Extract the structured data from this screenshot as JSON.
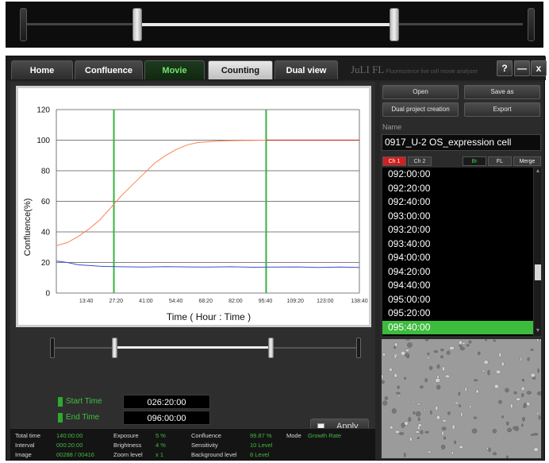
{
  "tabs": [
    {
      "label": "Home"
    },
    {
      "label": "Confluence"
    },
    {
      "label": "Movie"
    },
    {
      "label": "Counting"
    },
    {
      "label": "Dual view"
    }
  ],
  "brand": {
    "name": "JuLI FL",
    "tagline": "Fluorescence live cell movie analyzer"
  },
  "window_buttons": {
    "help": "?",
    "minimize": "—",
    "close": "x"
  },
  "chart_data": {
    "type": "line",
    "xlabel": "Time ( Hour : Time )",
    "ylabel": "Confluence(%)",
    "ylim": [
      0,
      120
    ],
    "yticks": [
      0,
      20,
      40,
      60,
      80,
      100,
      120
    ],
    "xlim": [
      0,
      138.67
    ],
    "xticks": [
      {
        "value": 13.67,
        "label": "13:40"
      },
      {
        "value": 27.33,
        "label": "27:20"
      },
      {
        "value": 41.0,
        "label": "41:00"
      },
      {
        "value": 54.67,
        "label": "54:40"
      },
      {
        "value": 68.33,
        "label": "68:20"
      },
      {
        "value": 82.0,
        "label": "82:00"
      },
      {
        "value": 95.67,
        "label": "95:40"
      },
      {
        "value": 109.33,
        "label": "109:20"
      },
      {
        "value": 123.0,
        "label": "123:00"
      },
      {
        "value": 138.67,
        "label": "138:40"
      }
    ],
    "markers": [
      26.33,
      96.0
    ],
    "grid": true,
    "series": [
      {
        "color": "#ff7f50",
        "line_color_late": "#c0392b",
        "x": [
          0,
          5,
          10,
          15,
          20,
          25,
          30,
          35,
          40,
          45,
          50,
          55,
          60,
          65,
          70,
          75,
          80,
          85,
          90,
          96,
          100,
          110,
          120,
          130,
          138.67
        ],
        "y": [
          31,
          33,
          37,
          42,
          48,
          56,
          64,
          71,
          78,
          85,
          90,
          94,
          97,
          98.5,
          99,
          99.5,
          99.7,
          99.8,
          99.9,
          100,
          100,
          100,
          100,
          100,
          100
        ]
      },
      {
        "color": "#3b4fd0",
        "x": [
          0,
          5,
          10,
          20,
          30,
          40,
          50,
          60,
          70,
          80,
          90,
          100,
          110,
          120,
          130,
          138.67
        ],
        "y": [
          21,
          20,
          18.5,
          17.5,
          17.2,
          17,
          17.3,
          17.1,
          17,
          17.2,
          16.9,
          17,
          17.1,
          16.8,
          17,
          16.8
        ]
      }
    ]
  },
  "time_range": {
    "start_label": "Start Time",
    "start_value": "026:20:00",
    "end_label": "End Time",
    "end_value": "096:00:00",
    "apply_label": "Apply"
  },
  "status": {
    "total_time_label": "Total time",
    "total_time": "140:00:00",
    "interval_label": "Interval",
    "interval": "000:20:00",
    "image_label": "Image",
    "image": "00288 / 00416",
    "exposure_label": "Exposure",
    "exposure": "5 %",
    "brightness_label": "Brightness",
    "brightness": "4 %",
    "zoom_label": "Zoom level",
    "zoom": "x 1",
    "confluence_label": "Confluence",
    "confluence": "99.87 %",
    "sensitivity_label": "Sensitivity",
    "sensitivity": "10 Level",
    "background_label": "Background level",
    "background": "8 Level",
    "mode_label": "Mode",
    "mode": "Growth Rate"
  },
  "actions": {
    "open": "Open",
    "save_as": "Save as",
    "dual": "Dual project creation",
    "export": "Export"
  },
  "name": {
    "label": "Name",
    "value": "0917_U-2 OS_expression cell"
  },
  "channels": {
    "ch1": "Ch 1",
    "ch2": "Ch 2",
    "br": "Br",
    "fl": "FL",
    "merge": "Merge"
  },
  "timepoints": [
    "092:00:00",
    "092:20:00",
    "092:40:00",
    "093:00:00",
    "093:20:00",
    "093:40:00",
    "094:00:00",
    "094:20:00",
    "094:40:00",
    "095:00:00",
    "095:20:00",
    "095:40:00"
  ],
  "selected_timepoint_index": 11,
  "top_slider": {
    "range_start": 0.21,
    "range_end": 0.72
  }
}
